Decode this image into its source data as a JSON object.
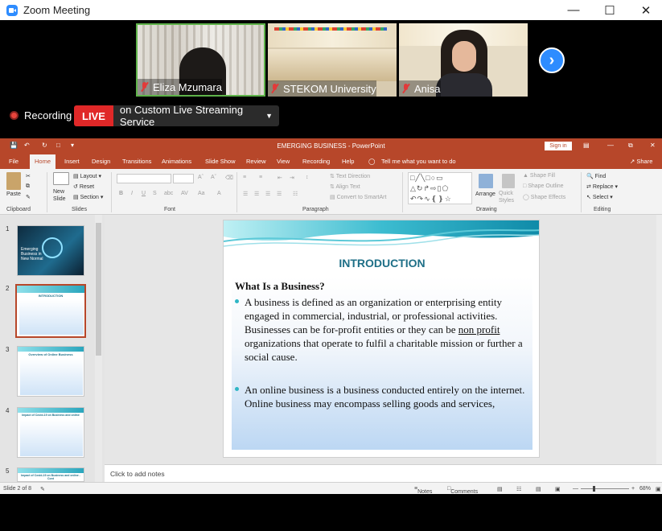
{
  "zoom": {
    "window_title": "Zoom Meeting",
    "participants": [
      {
        "name": "Eliza Mzumara"
      },
      {
        "name": "STEKOM University"
      },
      {
        "name": "Anisa"
      }
    ],
    "recording_label": "Recording",
    "live_tag": "LIVE",
    "live_service": "on Custom Live Streaming Service"
  },
  "powerpoint": {
    "window_title": "EMERGING BUSINESS - PowerPoint",
    "sign_in": "Sign in",
    "tabs": [
      "File",
      "Home",
      "Insert",
      "Design",
      "Transitions",
      "Animations",
      "Slide Show",
      "Review",
      "View",
      "Recording",
      "Help"
    ],
    "tell_me": "Tell me what you want to do",
    "share": "Share",
    "ribbon": {
      "paste": "Paste",
      "new_slide": "New Slide",
      "layout": "Layout",
      "reset": "Reset",
      "section": "Section",
      "text_direction": "Text Direction",
      "align_text": "Align Text",
      "convert_smartart": "Convert to SmartArt",
      "arrange": "Arrange",
      "quick_styles": "Quick Styles",
      "shape_fill": "Shape Fill",
      "shape_outline": "Shape Outline",
      "shape_effects": "Shape Effects",
      "find": "Find",
      "replace": "Replace",
      "select": "Select",
      "groups": {
        "clipboard": "Clipboard",
        "slides": "Slides",
        "font": "Font",
        "paragraph": "Paragraph",
        "drawing": "Drawing",
        "editing": "Editing"
      }
    },
    "thumbnails": [
      {
        "num": "1",
        "title": "Emerging Business in New Normal"
      },
      {
        "num": "2",
        "title": "INTRODUCTION"
      },
      {
        "num": "3",
        "title": "Overview of Online Business"
      },
      {
        "num": "4",
        "title": "Impact of Covid-19 on Business and online"
      },
      {
        "num": "5",
        "title": "Impact of Covid-19 on Business and online - Cont"
      }
    ],
    "slide": {
      "title": "INTRODUCTION",
      "heading": "What Is a Business?",
      "bullet1_a": "A business is defined as an organization or enterprising entity engaged in commercial, industrial, or professional activities. Businesses can be for-profit entities or they can be ",
      "bullet1_link": "non profit ",
      "bullet1_b": "organizations that operate to fulfil a charitable mission or further a social cause.",
      "bullet2": "An online business is a business conducted entirely on the internet. Online business may encompass selling goods and services,"
    },
    "notes_placeholder": "Click to add notes",
    "status": {
      "slide_of": "Slide 2 of 8",
      "notes": "Notes",
      "comments": "Comments",
      "zoom": "68%"
    }
  }
}
